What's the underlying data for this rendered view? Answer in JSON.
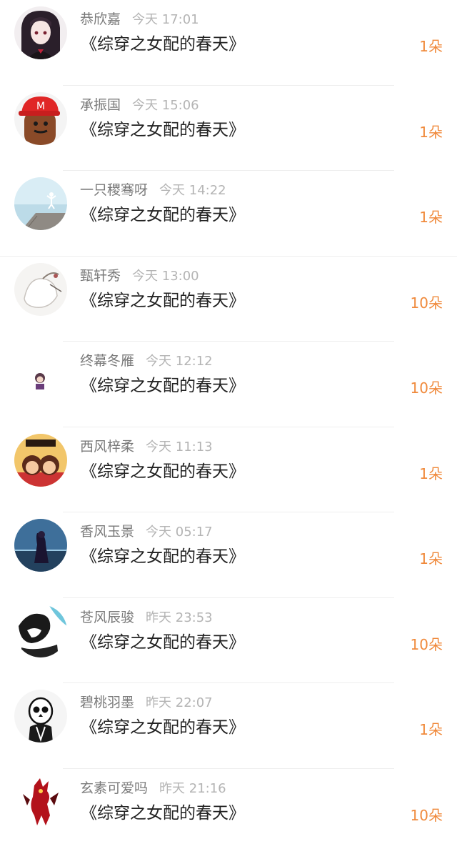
{
  "colors": {
    "name": "#7a7a7a",
    "time": "#b4b4b4",
    "gift": "#222222",
    "count": "#f08a3c",
    "divider": "#eeeeee"
  },
  "entries": [
    {
      "name": "恭欣嘉",
      "time": "今天 17:01",
      "gift": "《综穿之女配的春天》",
      "count": "1朵",
      "avatar": "anime-girl-avatar"
    },
    {
      "name": "承振国",
      "time": "今天 15:06",
      "gift": "《综穿之女配的春天》",
      "count": "1朵",
      "avatar": "red-cap-avatar"
    },
    {
      "name": "一只稷骞呀",
      "time": "今天 14:22",
      "gift": "《综穿之女配的春天》",
      "count": "1朵",
      "avatar": "yoga-pier-avatar"
    },
    {
      "name": "甄轩秀",
      "time": "今天 13:00",
      "gift": "《综穿之女配的春天》",
      "count": "10朵",
      "avatar": "sketch-avatar"
    },
    {
      "name": "终幕冬雁",
      "time": "今天 12:12",
      "gift": "《综穿之女配的春天》",
      "count": "10朵",
      "avatar": "chibi-avatar"
    },
    {
      "name": "西风梓柔",
      "time": "今天 11:13",
      "gift": "《综穿之女配的春天》",
      "count": "1朵",
      "avatar": "couple-cartoon-avatar"
    },
    {
      "name": "香风玉景",
      "time": "今天 05:17",
      "gift": "《综穿之女配的春天》",
      "count": "1朵",
      "avatar": "night-girl-avatar"
    },
    {
      "name": "苍风辰骏",
      "time": "昨天 23:53",
      "gift": "《综穿之女配的春天》",
      "count": "10朵",
      "avatar": "ink-anime-avatar"
    },
    {
      "name": "碧桃羽墨",
      "time": "昨天 22:07",
      "gift": "《综穿之女配的春天》",
      "count": "1朵",
      "avatar": "skull-avatar"
    },
    {
      "name": "玄素可爱吗",
      "time": "昨天 21:16",
      "gift": "《综穿之女配的春天》",
      "count": "10朵",
      "avatar": "red-warrior-avatar"
    }
  ]
}
